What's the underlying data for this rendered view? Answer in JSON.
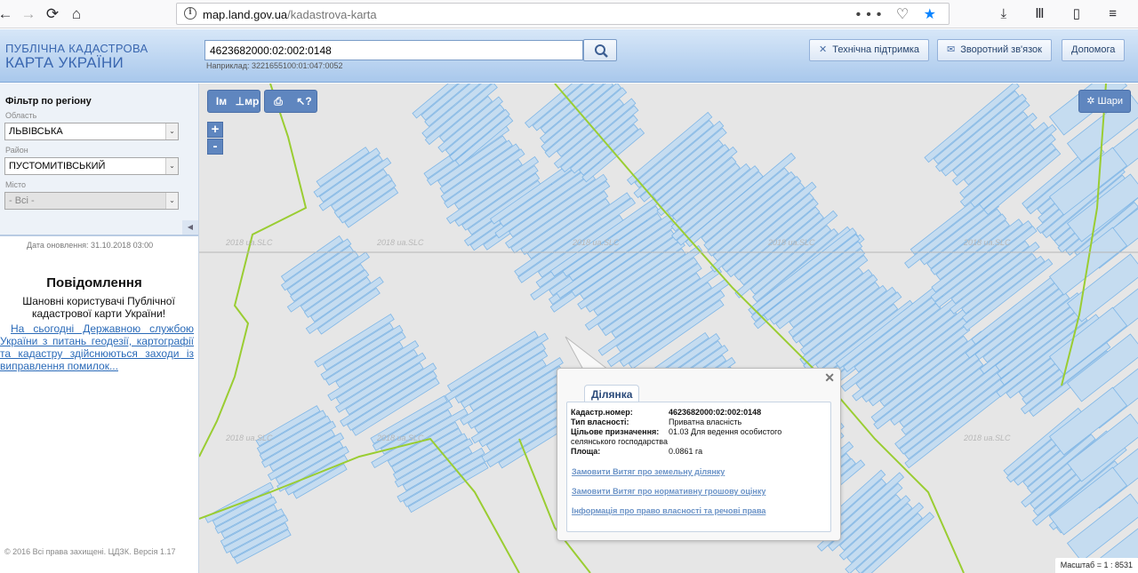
{
  "browser": {
    "url_domain": "map.land.gov.ua",
    "url_path": "/kadastrova-karta",
    "back_glyph": "←",
    "forward_glyph": "→",
    "reload_glyph": "⟳",
    "home_glyph": "⌂",
    "info_glyph": "i",
    "menu_glyph": "•••",
    "pocket_glyph": "♡",
    "star_glyph": "★",
    "download_glyph": "⤓",
    "library_glyph": "Ⅲ",
    "sidebar_glyph": "▯",
    "hamburger_glyph": "≡"
  },
  "header": {
    "logo_line1": "ПУБЛІЧНА КАДАСТРОВА",
    "logo_line2": "КАРТА УКРАЇНИ",
    "search_value": "4623682000:02:002:0148",
    "example": "Наприклад: 3221655100:01:047:0052",
    "support_icon": "✕",
    "support_label": "Технічна підтримка",
    "feedback_icon": "✉",
    "feedback_label": "Зворотний зв'язок",
    "help_label": "Допомога"
  },
  "filter": {
    "title": "Фільтр по регіону",
    "oblast_label": "Область",
    "oblast_value": "ЛЬВІВСЬКА",
    "rayon_label": "Район",
    "rayon_value": "ПУСТОМИТІВСЬКИЙ",
    "misto_label": "Місто",
    "misto_value": "- Всі -",
    "arrow": "⌄",
    "collapse": "◀"
  },
  "info": {
    "update_date": "Дата оновлення: 31.10.2018 03:00",
    "message_title": "Повідомлення",
    "message_body": "Шановні користувачі Публічної кадастрової карти України!",
    "message_link": "На сьогодні Державною службою України з питань геодезії, картографії та кадастру здійснюються заходи із виправлення помилок...",
    "copyright": "© 2016 Всі права захищені. ЦДЗК. Версія 1.17"
  },
  "map": {
    "tool_m": "Iм",
    "tool_mp": "⊥мр",
    "tool_print": "⎙",
    "tool_info": "↖?",
    "zoom_in": "+",
    "zoom_out": "-",
    "layers_icon": "✲",
    "layers_label": "Шари",
    "scale": "Масштаб = 1 : 8531",
    "watermark": "2018 ua.SLC"
  },
  "popup": {
    "tab": "Ділянка",
    "close": "✕",
    "cad_label": "Кадастр.номер:",
    "cad_value": "4623682000:02:002:0148",
    "own_label": "Тип власності:",
    "own_value": "Приватна власність",
    "purpose_label": "Цільове призначення:",
    "purpose_value": "01.03 Для ведення особистого селянського господарства",
    "area_label": "Площа:",
    "area_value": "0.0861 га",
    "link1": "Замовити Витяг про земельну ділянку",
    "link2": "Замовити Витяг про нормативну грошову оцінку",
    "link3": "Інформація про право власності та речові права"
  },
  "colors": {
    "parcel_fill": "#c5dcf0",
    "parcel_stroke": "#7fb6e6",
    "boundary": "#9acd32",
    "header_blue": "#a9c8ec"
  }
}
